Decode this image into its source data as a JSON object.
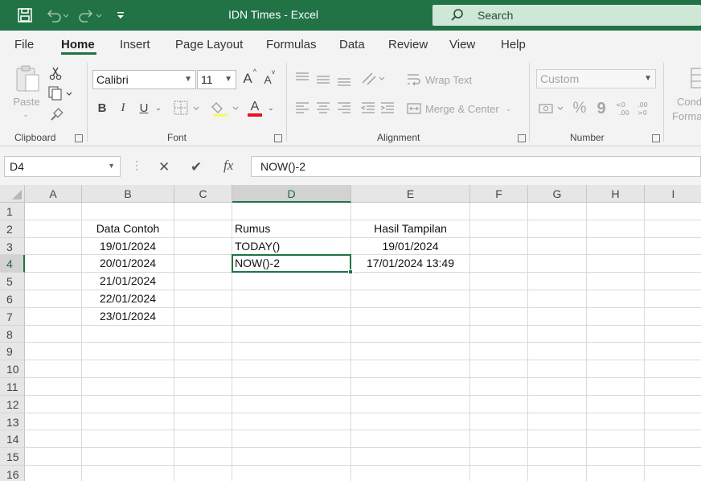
{
  "window": {
    "title": "IDN Times  -  Excel",
    "search_label": "Search",
    "accent_color": "#217346"
  },
  "menu": {
    "items": [
      "File",
      "Home",
      "Insert",
      "Page Layout",
      "Formulas",
      "Data",
      "Review",
      "View",
      "Help"
    ],
    "active": "Home"
  },
  "ribbon": {
    "clipboard": {
      "label": "Clipboard",
      "paste_label": "Paste"
    },
    "font": {
      "label": "Font",
      "font_name": "Calibri",
      "font_size": "11",
      "bold": "B",
      "italic": "I",
      "underline": "U",
      "grow": "A",
      "shrink": "A",
      "color_letter": "A",
      "font_color": "#e81123"
    },
    "alignment": {
      "label": "Alignment",
      "wrap_text": "Wrap Text",
      "merge_center": "Merge & Center"
    },
    "number": {
      "label": "Number",
      "format": "Custom",
      "percent": "%",
      "comma": "9"
    },
    "styles": {
      "cond_label_1": "Cond",
      "cond_label_2": "Forma"
    }
  },
  "formula_bar": {
    "name_box": "D4",
    "formula": "NOW()-2",
    "fx": "fx"
  },
  "sheet": {
    "columns": [
      "A",
      "B",
      "C",
      "D",
      "E",
      "F",
      "G",
      "H",
      "I"
    ],
    "selected_column": "D",
    "rows": [
      "1",
      "2",
      "3",
      "4",
      "5",
      "6",
      "7",
      "8",
      "9",
      "10",
      "11",
      "12",
      "13",
      "14",
      "15",
      "16"
    ],
    "selected_row": "4",
    "cells": {
      "B2": "Data Contoh",
      "B3": "19/01/2024",
      "B4": "20/01/2024",
      "B5": "21/01/2024",
      "B6": "22/01/2024",
      "B7": "23/01/2024",
      "D2": "Rumus",
      "D3": "TODAY()",
      "D4": "NOW()-2",
      "E2": "Hasil Tampilan",
      "E3": "19/01/2024",
      "E4": "17/01/2024 13:49"
    },
    "active_cell": "D4"
  }
}
